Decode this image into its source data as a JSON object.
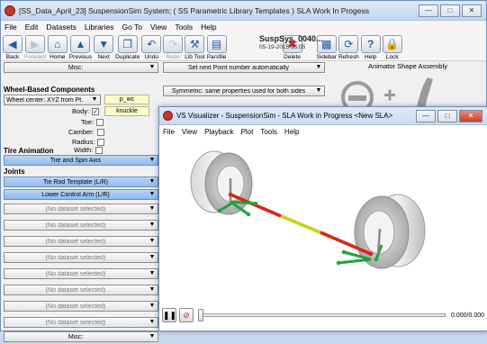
{
  "main": {
    "title": "[SS_Data_April_23] SuspensionSim System; ( SS Parametric Library Templates ) SLA Work In Progess",
    "menu": [
      "File",
      "Edit",
      "Datasets",
      "Libraries",
      "Go To",
      "View",
      "Tools",
      "Help"
    ],
    "toolbar": {
      "back": "Back",
      "forward": "Forward",
      "home": "Home",
      "previous": "Previous",
      "next": "Next",
      "duplicate": "Duplicate",
      "undo": "Undo",
      "redo": "Redo",
      "lib_tool": "Lib Tool",
      "parsfile": "Parsfile",
      "delete": "Delete",
      "sidebar": "Sidebar",
      "refresh": "Refresh",
      "help": "Help",
      "lock": "Lock"
    },
    "file_name": "SuspSys_0040...",
    "file_date": "05-19-2015 15:05"
  },
  "left": {
    "misc_top": "Misc:",
    "wheel_header": "Wheel-Based Components",
    "wheel_center": "Wheel center: XYZ from Pt.",
    "p_wc": "p_wc",
    "body": "Body:",
    "knuckle": "knuckle",
    "toe": "Toe:",
    "camber": "Camber:",
    "radius": "Radius:",
    "width": "Width:",
    "tire_header": "Tire Animation",
    "tire_spin": "Tire and Spin Axis",
    "joints_header": "Joints",
    "tie_rod": "Tie Rod Template (L/R)",
    "lower_arm": "Lower Control Arm (L/R)",
    "no_dataset": "(No dataset selected)",
    "misc_bottom": "Misc:"
  },
  "center": {
    "set_next": "Set next Point number automatically",
    "symmetric": "Symmetric: same properties used for both sides"
  },
  "right": {
    "animator_title": "Animator Shape Assembly"
  },
  "visualizer": {
    "title": "VS Visualizer - SuspensionSim - SLA Work in Progress <New SLA>",
    "menu": [
      "File",
      "View",
      "Playback",
      "Plot",
      "Tools",
      "Help"
    ],
    "time_readout": "0.000/0.000"
  },
  "colors": {
    "tie_rod": "#d9241e",
    "lower_arm": "#1fa33a",
    "axle": "#e2b400",
    "blue_combo": "#a7c9f5"
  }
}
